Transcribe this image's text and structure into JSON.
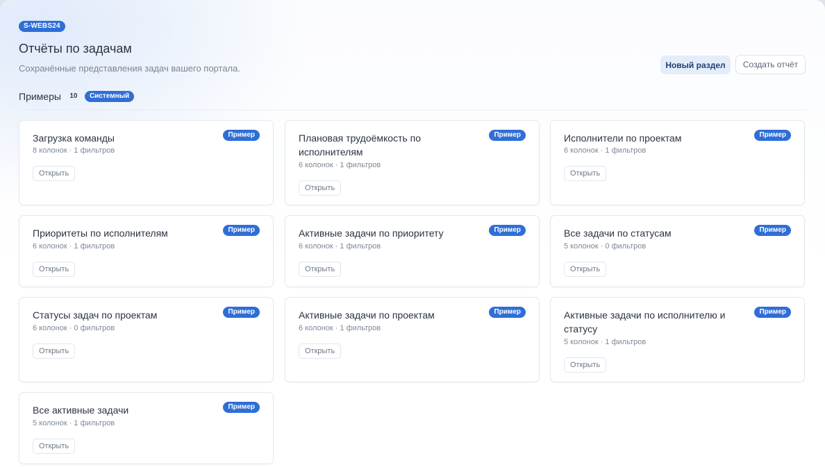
{
  "portal": {
    "code": "S-WEBS24"
  },
  "header": {
    "title": "Отчёты по задачам",
    "subtitle": "Сохранённые представления задач вашего портала.",
    "new_section_label": "Новый раздел",
    "create_report_label": "Создать отчёт"
  },
  "section": {
    "title": "Примеры",
    "count": "10",
    "system_badge": "Системный"
  },
  "colors": {
    "accent": "#2f6ed6",
    "soft_button_bg": "#e4edfa"
  },
  "cards": [
    {
      "title": "Загрузка команды",
      "badge": "Пример",
      "meta": "8 колонок · 1 фильтров",
      "open_label": "Открыть"
    },
    {
      "title": "Плановая трудоёмкость по исполнителям",
      "badge": "Пример",
      "meta": "6 колонок · 1 фильтров",
      "open_label": "Открыть"
    },
    {
      "title": "Исполнители по проектам",
      "badge": "Пример",
      "meta": "6 колонок · 1 фильтров",
      "open_label": "Открыть"
    },
    {
      "title": "Приоритеты по исполнителям",
      "badge": "Пример",
      "meta": "6 колонок · 1 фильтров",
      "open_label": "Открыть"
    },
    {
      "title": "Активные задачи по приоритету",
      "badge": "Пример",
      "meta": "6 колонок · 1 фильтров",
      "open_label": "Открыть"
    },
    {
      "title": "Все задачи по статусам",
      "badge": "Пример",
      "meta": "5 колонок · 0 фильтров",
      "open_label": "Открыть"
    },
    {
      "title": "Статусы задач по проектам",
      "badge": "Пример",
      "meta": "6 колонок · 0 фильтров",
      "open_label": "Открыть"
    },
    {
      "title": "Активные задачи по проектам",
      "badge": "Пример",
      "meta": "6 колонок · 1 фильтров",
      "open_label": "Открыть"
    },
    {
      "title": "Активные задачи по исполнителю и статусу",
      "badge": "Пример",
      "meta": "5 колонок · 1 фильтров",
      "open_label": "Открыть"
    },
    {
      "title": "Все активные задачи",
      "badge": "Пример",
      "meta": "5 колонок · 1 фильтров",
      "open_label": "Открыть"
    }
  ]
}
